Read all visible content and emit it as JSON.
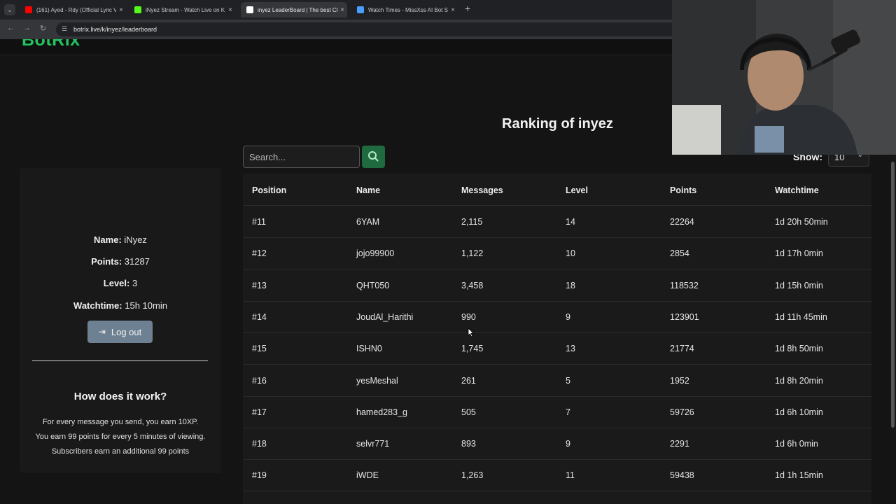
{
  "browser": {
    "tabs": [
      {
        "title": "(161) Ayed - Rdy (Official Lyric V",
        "favicon_color": "#ff0000",
        "active": false
      },
      {
        "title": "iNyez Stream - Watch Live on K",
        "favicon_color": "#53fc18",
        "active": false
      },
      {
        "title": "inyez LeaderBoard | The best Ch",
        "favicon_color": "#ffffff",
        "active": true
      },
      {
        "title": "Watch Times - MissXss AI Bot S",
        "favicon_color": "#4a9eff",
        "active": false
      }
    ],
    "new_tab": "+",
    "url": "botrix.live/k/inyez/leaderboard"
  },
  "site": {
    "logo": "BotRix",
    "accent": "#22c55e"
  },
  "page": {
    "title": "Ranking of inyez",
    "search_placeholder": "Search...",
    "show_label": "Show:",
    "show_value": "10"
  },
  "sidebar": {
    "name_label": "Name:",
    "name": "iNyez",
    "points_label": "Points:",
    "points": "31287",
    "level_label": "Level:",
    "level": "3",
    "watchtime_label": "Watchtime:",
    "watchtime": "15h 10min",
    "logout_label": "Log out",
    "how_title": "How does it work?",
    "how_lines": [
      "For every message you send, you earn 10XP.",
      "You earn 99 points for every 5 minutes of viewing.",
      "Subscribers earn an additional 99 points"
    ]
  },
  "table": {
    "headers": [
      "Position",
      "Name",
      "Messages",
      "Level",
      "Points",
      "Watchtime"
    ],
    "rows": [
      [
        "#11",
        "6YAM",
        "2,115",
        "14",
        "22264",
        "1d 20h 50min"
      ],
      [
        "#12",
        "jojo99900",
        "1,122",
        "10",
        "2854",
        "1d 17h 0min"
      ],
      [
        "#13",
        "QHT050",
        "3,458",
        "18",
        "118532",
        "1d 15h 0min"
      ],
      [
        "#14",
        "JoudAl_Harithi",
        "990",
        "9",
        "123901",
        "1d 11h 45min"
      ],
      [
        "#15",
        "ISHN0",
        "1,745",
        "13",
        "21774",
        "1d 8h 50min"
      ],
      [
        "#16",
        "yesMeshal",
        "261",
        "5",
        "1952",
        "1d 8h 20min"
      ],
      [
        "#17",
        "hamed283_g",
        "505",
        "7",
        "59726",
        "1d 6h 10min"
      ],
      [
        "#18",
        "selvr771",
        "893",
        "9",
        "2291",
        "1d 6h 0min"
      ],
      [
        "#19",
        "iWDE",
        "1,263",
        "11",
        "59438",
        "1d 1h 15min"
      ]
    ]
  }
}
